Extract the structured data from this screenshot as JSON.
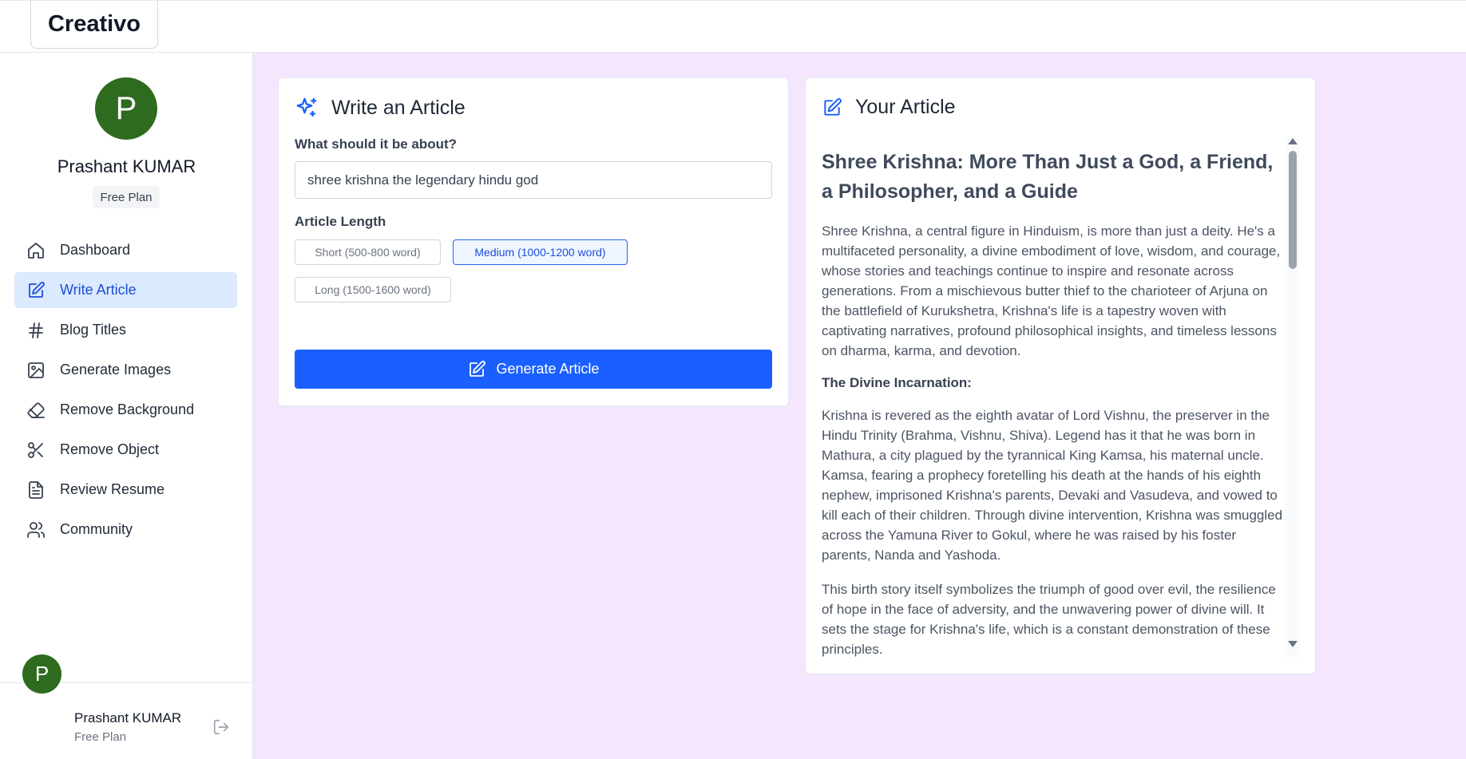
{
  "app": {
    "logo": "Creativo"
  },
  "user": {
    "initial": "P",
    "name": "Prashant KUMAR",
    "plan": "Free Plan"
  },
  "nav": [
    {
      "label": "Dashboard",
      "icon": "home-icon",
      "active": false
    },
    {
      "label": "Write Article",
      "icon": "edit-icon",
      "active": true
    },
    {
      "label": "Blog Titles",
      "icon": "hash-icon",
      "active": false
    },
    {
      "label": "Generate Images",
      "icon": "image-icon",
      "active": false
    },
    {
      "label": "Remove Background",
      "icon": "eraser-icon",
      "active": false
    },
    {
      "label": "Remove Object",
      "icon": "scissors-icon",
      "active": false
    },
    {
      "label": "Review Resume",
      "icon": "file-text-icon",
      "active": false
    },
    {
      "label": "Community",
      "icon": "users-icon",
      "active": false
    }
  ],
  "form": {
    "title": "Write an Article",
    "topic_label": "What should it be about?",
    "topic_value": "shree krishna the legendary hindu god",
    "length_label": "Article Length",
    "lengths": [
      "Short (500-800 word)",
      "Medium (1000-1200 word)",
      "Long (1500-1600 word)"
    ],
    "selected_length": "Medium (1000-1200 word)",
    "generate_label": "Generate Article"
  },
  "article": {
    "panel_title": "Your Article",
    "title": "Shree Krishna: More Than Just a God, a Friend, a Philosopher, and a Guide",
    "p1": "Shree Krishna, a central figure in Hinduism, is more than just a deity. He's a multifaceted personality, a divine embodiment of love, wisdom, and courage, whose stories and teachings continue to inspire and resonate across generations. From a mischievous butter thief to the charioteer of Arjuna on the battlefield of Kurukshetra, Krishna's life is a tapestry woven with captivating narratives, profound philosophical insights, and timeless lessons on dharma, karma, and devotion.",
    "h1": "The Divine Incarnation:",
    "p2": "Krishna is revered as the eighth avatar of Lord Vishnu, the preserver in the Hindu Trinity (Brahma, Vishnu, Shiva). Legend has it that he was born in Mathura, a city plagued by the tyrannical King Kamsa, his maternal uncle. Kamsa, fearing a prophecy foretelling his death at the hands of his eighth nephew, imprisoned Krishna's parents, Devaki and Vasudeva, and vowed to kill each of their children. Through divine intervention, Krishna was smuggled across the Yamuna River to Gokul, where he was raised by his foster parents, Nanda and Yashoda.",
    "p3": "This birth story itself symbolizes the triumph of good over evil, the resilience of hope in the face of adversity, and the unwavering power of divine will. It sets the stage for Krishna's life, which is a constant demonstration of these principles."
  },
  "colors": {
    "accent": "#1a5fff",
    "main_bg": "#f3e6fd",
    "avatar_bg": "#2e6b1f",
    "active_nav_bg": "#dbeafe"
  }
}
